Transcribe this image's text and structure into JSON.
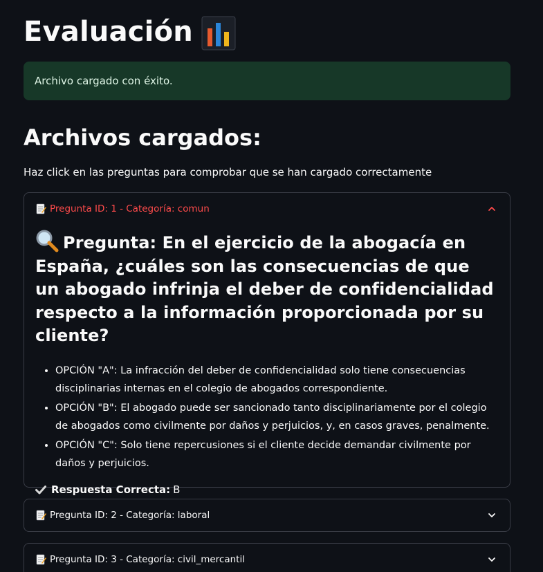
{
  "header": {
    "title": "Evaluación",
    "title_icon": "bar-chart-emoji"
  },
  "alert": {
    "text": "Archivo cargado con éxito.",
    "color": "#173828"
  },
  "section": {
    "title": "Archivos cargados:",
    "hint": "Haz click en las preguntas para comprobar que se han cargado correctamente"
  },
  "expanders": [
    {
      "label": "Pregunta ID: 1 - Categoría: comun",
      "icon": "memo-emoji",
      "expanded": true,
      "question": "Pregunta: En el ejercicio de la abogacía en España, ¿cuáles son las consecuencias de que un abogado infrinja el deber de confidencialidad respecto a la información proporcionada por su cliente?",
      "question_icon": "magnifier-emoji",
      "options": [
        "OPCIÓN \"A\": La infracción del deber de confidencialidad solo tiene consecuencias disciplinarias internas en el colegio de abogados correspondiente.",
        "OPCIÓN \"B\": El abogado puede ser sancionado tanto disciplinariamente por el colegio de abogados como civilmente por daños y perjuicios, y, en casos graves, penalmente.",
        "OPCIÓN \"C\": Solo tiene repercusiones si el cliente decide demandar civilmente por daños y perjuicios."
      ],
      "answer_label": "Respuesta Correcta:",
      "answer_value": "B"
    },
    {
      "label": "Pregunta ID: 2 - Categoría: laboral",
      "icon": "memo-emoji",
      "expanded": false
    },
    {
      "label": "Pregunta ID: 3 - Categoría: civil_mercantil",
      "icon": "memo-emoji",
      "expanded": false
    }
  ],
  "colors": {
    "background": "#0e1117",
    "accent": "#ff4b4b",
    "border": "#3a3d47"
  }
}
